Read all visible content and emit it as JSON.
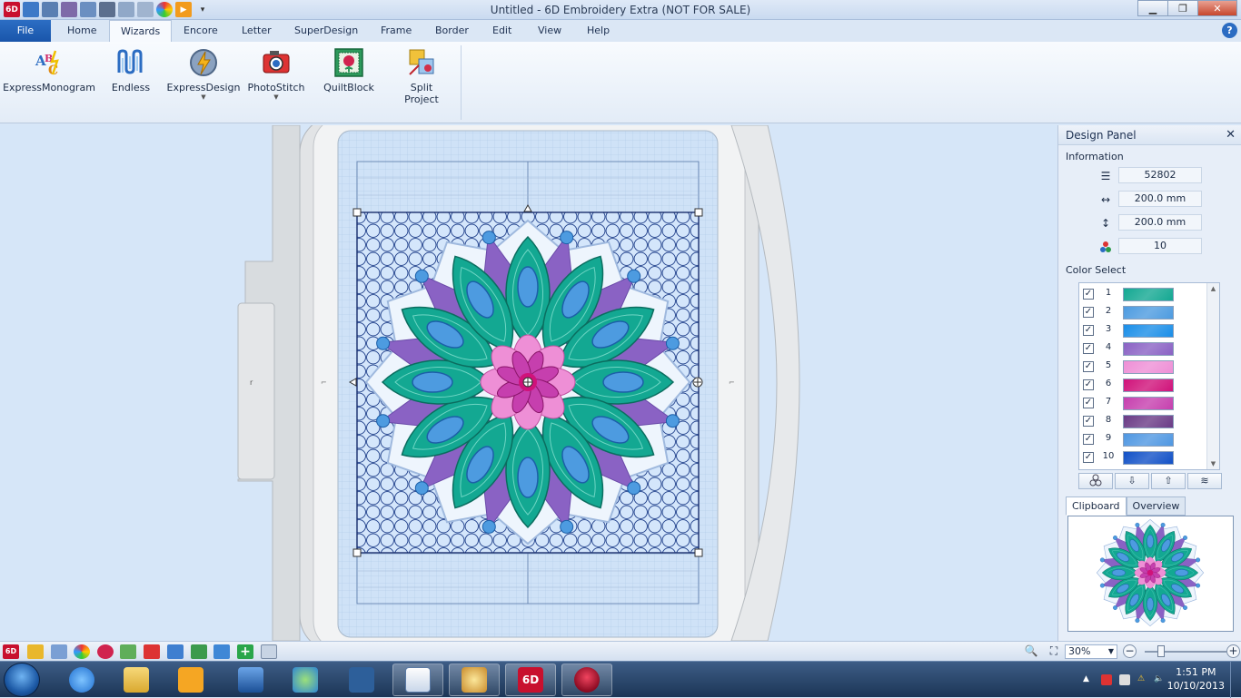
{
  "window": {
    "title": "Untitled - 6D Embroidery Extra (NOT FOR SALE)"
  },
  "quick_access": {
    "app_badge": "6D"
  },
  "menu_tabs": [
    {
      "label": "File"
    },
    {
      "label": "Home"
    },
    {
      "label": "Wizards",
      "active": true
    },
    {
      "label": "Encore"
    },
    {
      "label": "Letter"
    },
    {
      "label": "SuperDesign"
    },
    {
      "label": "Frame"
    },
    {
      "label": "Border"
    },
    {
      "label": "Edit"
    },
    {
      "label": "View"
    },
    {
      "label": "Help"
    }
  ],
  "help_label": "?",
  "ribbon": {
    "buttons": [
      {
        "label": "ExpressMonogram",
        "icon": "monogram-icon",
        "dropdown": false
      },
      {
        "label": "Endless",
        "icon": "endless-icon",
        "dropdown": false
      },
      {
        "label": "ExpressDesign",
        "icon": "expressdesign-icon",
        "dropdown": true
      },
      {
        "label": "PhotoStitch",
        "icon": "photostitch-icon",
        "dropdown": true
      },
      {
        "label": "QuiltBlock",
        "icon": "quiltblock-icon",
        "dropdown": false
      },
      {
        "label": "Split\nProject",
        "line1": "Split",
        "line2": "Project",
        "icon": "split-project-icon",
        "dropdown": false
      }
    ]
  },
  "design_panel": {
    "title": "Design Panel",
    "close_label": "✕",
    "information": {
      "heading": "Information",
      "stitches": "52802",
      "width": "200.0 mm",
      "height": "200.0 mm",
      "colors": "10"
    },
    "color_select": {
      "heading": "Color Select",
      "colors": [
        {
          "n": "1",
          "color": "#13a892",
          "checked": true
        },
        {
          "n": "2",
          "color": "#4d9be0",
          "checked": true
        },
        {
          "n": "3",
          "color": "#1a8ee8",
          "checked": true
        },
        {
          "n": "4",
          "color": "#8a62c4",
          "checked": true
        },
        {
          "n": "5",
          "color": "#ee8fd6",
          "checked": true
        },
        {
          "n": "6",
          "color": "#d0127a",
          "checked": true
        },
        {
          "n": "7",
          "color": "#c63fae",
          "checked": true
        },
        {
          "n": "8",
          "color": "#6a3b86",
          "checked": true
        },
        {
          "n": "9",
          "color": "#4f97e2",
          "checked": true
        },
        {
          "n": "10",
          "color": "#1251c7",
          "checked": true
        }
      ]
    },
    "tabs": [
      {
        "label": "Clipboard",
        "active": true
      },
      {
        "label": "Overview",
        "active": false
      }
    ]
  },
  "statusbar": {
    "zoom": "30%"
  },
  "taskbar": {
    "time": "1:51 PM",
    "date": "10/10/2013",
    "app_badge": "6D"
  },
  "colors": {
    "accent": "#1955aa",
    "hoop_bg": "#cfe2f7",
    "grid_line": "#8fb4dc",
    "teal": "#13a892",
    "purple": "#8a62c4",
    "pink": "#ee8fd6",
    "light_blue": "#4d9be0",
    "navy": "#1a3a86"
  }
}
